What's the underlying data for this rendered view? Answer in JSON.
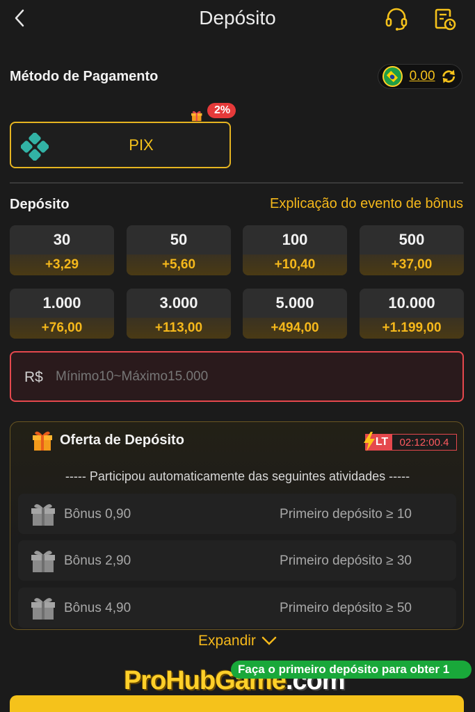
{
  "header": {
    "title": "Depósito",
    "back_icon": "chevron-left-icon",
    "support_icon": "headset-icon",
    "history_icon": "history-icon"
  },
  "payment": {
    "label": "Método de Pagamento",
    "balance": "0.00",
    "methods": [
      {
        "label": "PIX",
        "badge": "2%"
      }
    ]
  },
  "deposit": {
    "label": "Depósito",
    "bonus_link": "Explicação do evento de bônus",
    "amounts": [
      {
        "value": "30",
        "bonus": "+3,29"
      },
      {
        "value": "50",
        "bonus": "+5,60"
      },
      {
        "value": "100",
        "bonus": "+10,40"
      },
      {
        "value": "500",
        "bonus": "+37,00"
      },
      {
        "value": "1.000",
        "bonus": "+76,00"
      },
      {
        "value": "3.000",
        "bonus": "+113,00"
      },
      {
        "value": "5.000",
        "bonus": "+494,00"
      },
      {
        "value": "10.000",
        "bonus": "+1.199,00"
      }
    ],
    "currency": "R$",
    "input_placeholder": "Mínimo10~Máximo15.000"
  },
  "offer": {
    "title": "Oferta de Depósito",
    "lt_label": "LT",
    "timer": "02:12:00.4",
    "participate": "----- Participou automaticamente das seguintes atividades -----",
    "items": [
      {
        "name": "Bônus 0,90",
        "condition": "Primeiro depósito ≥ 10"
      },
      {
        "name": "Bônus 2,90",
        "condition": "Primeiro depósito ≥ 30"
      },
      {
        "name": "Bônus 4,90",
        "condition": "Primeiro depósito ≥ 50"
      }
    ],
    "expand": "Expandir"
  },
  "toast": "Faça o primeiro depósito para obter 1",
  "watermark": {
    "main": "ProHubGame",
    "suffix": ".com"
  },
  "colors": {
    "accent": "#f5c21b",
    "background": "#1b1b1b",
    "error": "#e5484d",
    "success": "#19a83a"
  }
}
